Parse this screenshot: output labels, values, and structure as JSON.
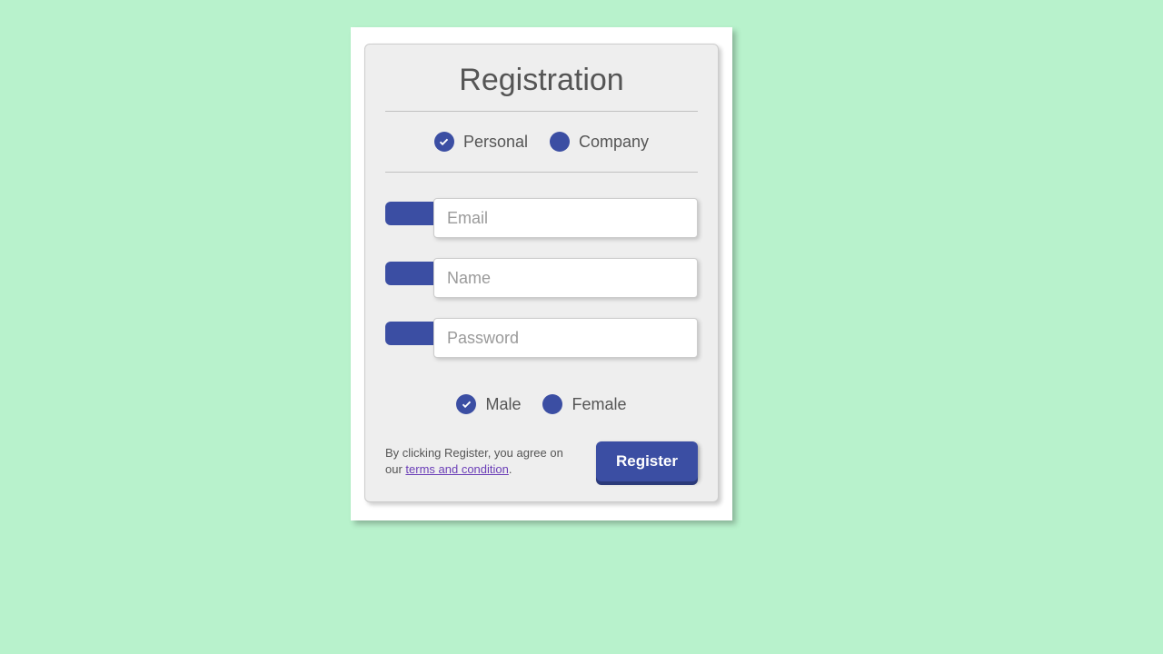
{
  "title": "Registration",
  "account_type": {
    "options": [
      {
        "label": "Personal",
        "selected": true
      },
      {
        "label": "Company",
        "selected": false
      }
    ]
  },
  "fields": {
    "email": {
      "label": "Email",
      "placeholder": "Email",
      "value": ""
    },
    "name": {
      "label": "Name",
      "placeholder": "Name",
      "value": ""
    },
    "password": {
      "label": "Password",
      "placeholder": "Password",
      "value": ""
    }
  },
  "gender": {
    "options": [
      {
        "label": "Male",
        "selected": true
      },
      {
        "label": "Female",
        "selected": false
      }
    ]
  },
  "footer": {
    "terms_prefix": "By clicking Register, you agree on our ",
    "terms_link": "terms and condition",
    "terms_suffix": ".",
    "button": "Register"
  }
}
